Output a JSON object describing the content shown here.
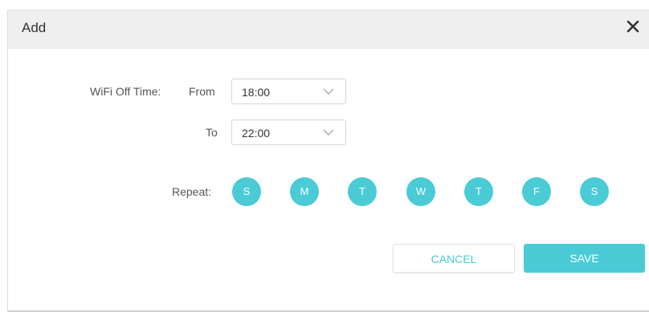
{
  "dialog": {
    "title": "Add",
    "close_icon": "close-icon"
  },
  "form": {
    "wifi_off_time_label": "WiFi Off Time:",
    "from_label": "From",
    "from_value": "18:00",
    "to_label": "To",
    "to_value": "22:00",
    "dropdown_icon": "chevron-down-icon",
    "repeat_label": "Repeat:",
    "days": [
      "S",
      "M",
      "T",
      "W",
      "T",
      "F",
      "S"
    ]
  },
  "actions": {
    "cancel_label": "CANCEL",
    "save_label": "SAVE"
  },
  "colors": {
    "accent": "#4acbd6",
    "header_bg": "#efefef",
    "text": "#555555"
  }
}
